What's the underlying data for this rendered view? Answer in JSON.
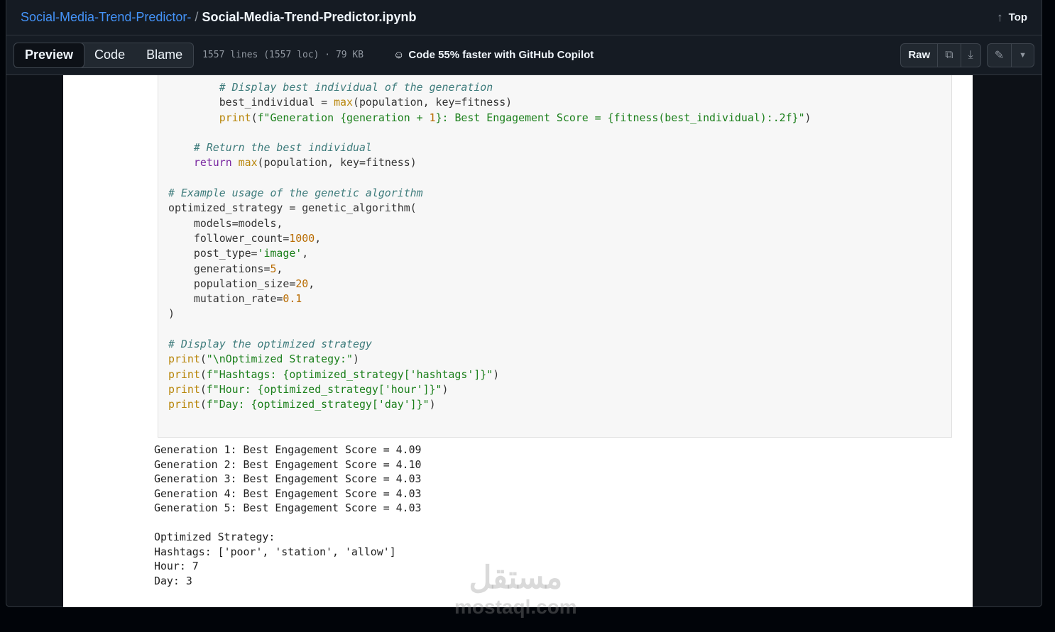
{
  "header": {
    "repo": "Social-Media-Trend-Predictor-",
    "separator": "/",
    "file": "Social-Media-Trend-Predictor.ipynb",
    "top": "Top"
  },
  "toolbar": {
    "tabs": [
      "Preview",
      "Code",
      "Blame"
    ],
    "meta": "1557 lines (1557 loc) · 79 KB",
    "copilot": "Code 55% faster with GitHub Copilot",
    "raw": "Raw"
  },
  "code": [
    [
      [
        "",
        "        "
      ],
      [
        "c",
        "# Display best individual of the generation"
      ]
    ],
    [
      [
        "",
        "        best_individual = "
      ],
      [
        "b",
        "max"
      ],
      [
        "",
        "(population, key=fitness)"
      ]
    ],
    [
      [
        "",
        "        "
      ],
      [
        "b",
        "print"
      ],
      [
        "",
        "("
      ],
      [
        "s",
        "f\"Generation {generation + "
      ],
      [
        "n",
        "1"
      ],
      [
        "s",
        "}: Best Engagement Score = {fitness(best_individual):.2f}\""
      ],
      [
        "",
        ")"
      ]
    ],
    [
      [
        "",
        ""
      ]
    ],
    [
      [
        "",
        "    "
      ],
      [
        "c",
        "# Return the best individual"
      ]
    ],
    [
      [
        "",
        "    "
      ],
      [
        "k",
        "return"
      ],
      [
        "",
        " "
      ],
      [
        "b",
        "max"
      ],
      [
        "",
        "(population, key=fitness)"
      ]
    ],
    [
      [
        "",
        ""
      ]
    ],
    [
      [
        "c",
        "# Example usage of the genetic algorithm"
      ]
    ],
    [
      [
        "",
        "optimized_strategy = genetic_algorithm("
      ]
    ],
    [
      [
        "",
        "    models=models,"
      ]
    ],
    [
      [
        "",
        "    follower_count="
      ],
      [
        "n",
        "1000"
      ],
      [
        "",
        ","
      ]
    ],
    [
      [
        "",
        "    post_type="
      ],
      [
        "s",
        "'image'"
      ],
      [
        "",
        ","
      ]
    ],
    [
      [
        "",
        "    generations="
      ],
      [
        "n",
        "5"
      ],
      [
        "",
        ","
      ]
    ],
    [
      [
        "",
        "    population_size="
      ],
      [
        "n",
        "20"
      ],
      [
        "",
        ","
      ]
    ],
    [
      [
        "",
        "    mutation_rate="
      ],
      [
        "n",
        "0.1"
      ]
    ],
    [
      [
        "",
        ")"
      ]
    ],
    [
      [
        "",
        ""
      ]
    ],
    [
      [
        "c",
        "# Display the optimized strategy"
      ]
    ],
    [
      [
        "b",
        "print"
      ],
      [
        "",
        "("
      ],
      [
        "s",
        "\"\\nOptimized Strategy:\""
      ],
      [
        "",
        ")"
      ]
    ],
    [
      [
        "b",
        "print"
      ],
      [
        "",
        "("
      ],
      [
        "s",
        "f\"Hashtags: {optimized_strategy['hashtags']}\""
      ],
      [
        "",
        ")"
      ]
    ],
    [
      [
        "b",
        "print"
      ],
      [
        "",
        "("
      ],
      [
        "s",
        "f\"Hour: {optimized_strategy['hour']}\""
      ],
      [
        "",
        ")"
      ]
    ],
    [
      [
        "b",
        "print"
      ],
      [
        "",
        "("
      ],
      [
        "s",
        "f\"Day: {optimized_strategy['day']}\""
      ],
      [
        "",
        ")"
      ]
    ]
  ],
  "output": [
    "Generation 1: Best Engagement Score = 4.09",
    "Generation 2: Best Engagement Score = 4.10",
    "Generation 3: Best Engagement Score = 4.03",
    "Generation 4: Best Engagement Score = 4.03",
    "Generation 5: Best Engagement Score = 4.03",
    "",
    "Optimized Strategy:",
    "Hashtags: ['poor', 'station', 'allow']",
    "Hour: 7",
    "Day: 3"
  ],
  "watermark": {
    "arabic": "مستقل",
    "latin": "mostaql.com"
  }
}
